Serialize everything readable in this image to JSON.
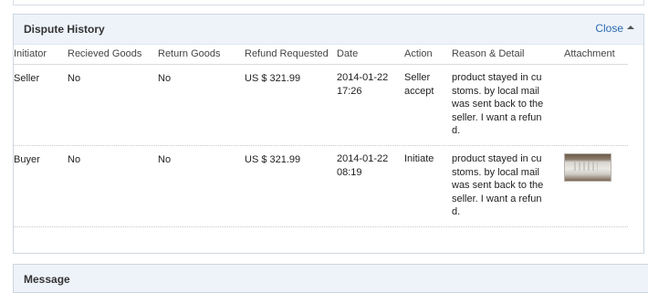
{
  "dispute_history": {
    "title": "Dispute History",
    "close_label": "Close",
    "columns": [
      "Initiator",
      "Recieved Goods",
      "Return Goods",
      "Refund Requested",
      "Date",
      "Action",
      "Reason & Detail",
      "Attachment"
    ],
    "rows": [
      {
        "initiator": "Seller",
        "received_goods": "No",
        "return_goods": "No",
        "refund_requested": "US $ 321.99",
        "date": "2014-01-22 17:26",
        "action": "Seller accept",
        "reason_detail": "product stayed in customs. by local mail was sent back to the seller. I want a refund.",
        "attachment": ""
      },
      {
        "initiator": "Buyer",
        "received_goods": "No",
        "return_goods": "No",
        "refund_requested": "US $ 321.99",
        "date": "2014-01-22 08:19",
        "action": "Initiate",
        "reason_detail": "product stayed in customs. by local mail was sent back to the seller. I want a refund.",
        "attachment": "thumbnail-image"
      }
    ]
  },
  "message_panel": {
    "title": "Message"
  },
  "colors": {
    "header_bg": "#eef3fa",
    "link": "#2a6bb0",
    "border": "#cdd6e0"
  }
}
